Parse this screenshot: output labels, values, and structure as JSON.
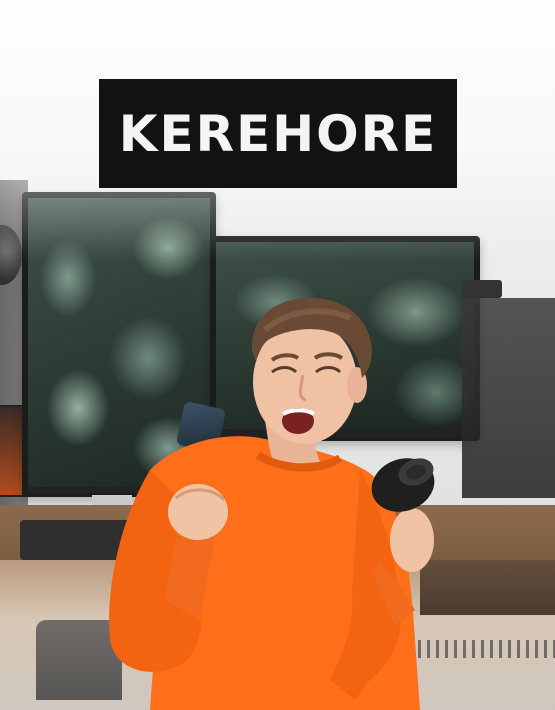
{
  "brand": {
    "title": "KEREHORE"
  },
  "photo": {
    "shirt_color": "#ff6f1a",
    "title_box_color": "#121212",
    "title_text_color": "#f4f4f4"
  }
}
